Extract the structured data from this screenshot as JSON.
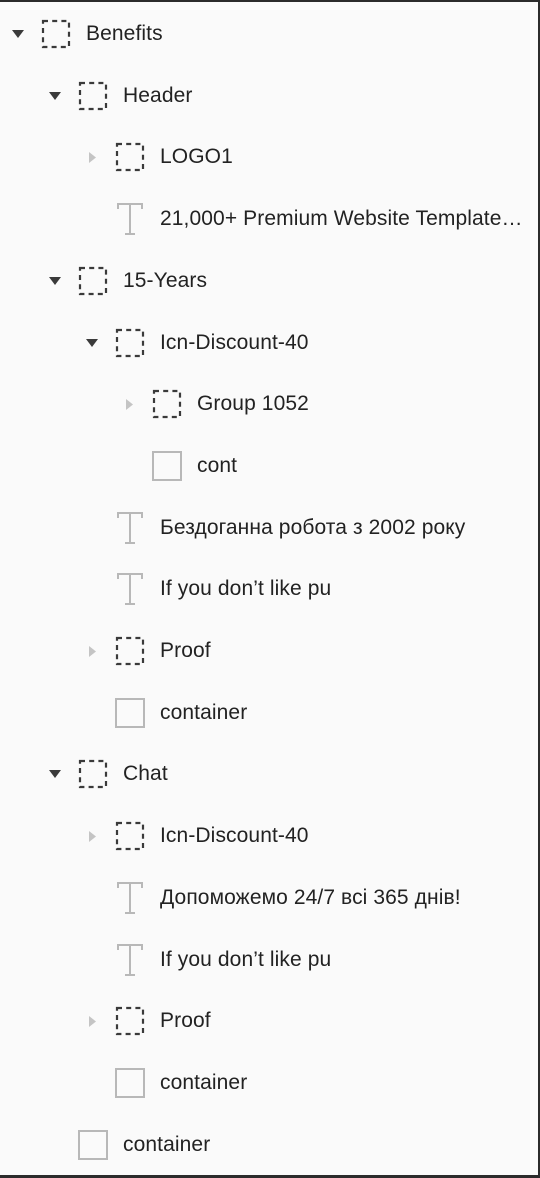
{
  "layers_panel": {
    "rows": [
      {
        "label": "Benefits",
        "type": "group",
        "toggle": "expanded",
        "depth": 0
      },
      {
        "label": "Header",
        "type": "group",
        "toggle": "expanded",
        "depth": 1
      },
      {
        "label": "LOGO1",
        "type": "group",
        "toggle": "collapsed",
        "depth": 2
      },
      {
        "label": "21,000+ Premium Website Template…",
        "type": "text",
        "toggle": "none",
        "depth": 2
      },
      {
        "label": "15-Years",
        "type": "group",
        "toggle": "expanded",
        "depth": 1
      },
      {
        "label": "Icn-Discount-40",
        "type": "group",
        "toggle": "expanded",
        "depth": 2
      },
      {
        "label": "Group 1052",
        "type": "group",
        "toggle": "collapsed",
        "depth": 3
      },
      {
        "label": "cont",
        "type": "rect",
        "toggle": "none",
        "depth": 3
      },
      {
        "label": "Бездоганна робота з 2002 року",
        "type": "text",
        "toggle": "none",
        "depth": 2
      },
      {
        "label": "If you don’t like pu",
        "type": "text",
        "toggle": "none",
        "depth": 2
      },
      {
        "label": "Proof",
        "type": "group",
        "toggle": "collapsed",
        "depth": 2
      },
      {
        "label": "container",
        "type": "rect",
        "toggle": "none",
        "depth": 2
      },
      {
        "label": "Chat",
        "type": "group",
        "toggle": "expanded",
        "depth": 1
      },
      {
        "label": "Icn-Discount-40",
        "type": "group",
        "toggle": "collapsed",
        "depth": 2
      },
      {
        "label": "Допоможемо 24/7 всі 365 днів!",
        "type": "text",
        "toggle": "none",
        "depth": 2
      },
      {
        "label": "If you don’t like pu",
        "type": "text",
        "toggle": "none",
        "depth": 2
      },
      {
        "label": "Proof",
        "type": "group",
        "toggle": "collapsed",
        "depth": 2
      },
      {
        "label": "container",
        "type": "rect",
        "toggle": "none",
        "depth": 2
      },
      {
        "label": "container",
        "type": "rect",
        "toggle": "none",
        "depth": 1
      }
    ]
  },
  "icons": {
    "group": "dashed-frame-icon",
    "text": "text-t-icon",
    "rect": "rectangle-icon",
    "expanded": "caret-down-icon",
    "collapsed": "caret-right-icon"
  },
  "colors": {
    "background": "#fafafa",
    "text": "#222222",
    "icon_dark": "#3a3a3a",
    "icon_light": "#b8b8b8",
    "caret_collapsed": "#c4c4c4"
  }
}
